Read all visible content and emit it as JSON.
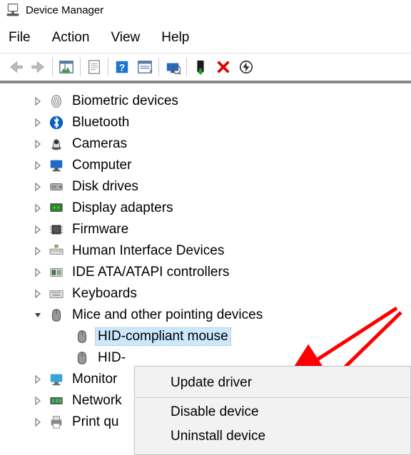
{
  "title": "Device Manager",
  "menu": [
    "File",
    "Action",
    "View",
    "Help"
  ],
  "tree": [
    {
      "name": "biometric",
      "icon": "fingerprint",
      "label": "Biometric devices",
      "level": 1,
      "expanded": false
    },
    {
      "name": "bluetooth",
      "icon": "bluetooth",
      "label": "Bluetooth",
      "level": 1,
      "expanded": false
    },
    {
      "name": "cameras",
      "icon": "camera",
      "label": "Cameras",
      "level": 1,
      "expanded": false
    },
    {
      "name": "computer",
      "icon": "computer",
      "label": "Computer",
      "level": 1,
      "expanded": false
    },
    {
      "name": "disk",
      "icon": "disk",
      "label": "Disk drives",
      "level": 1,
      "expanded": false
    },
    {
      "name": "display",
      "icon": "display",
      "label": "Display adapters",
      "level": 1,
      "expanded": false
    },
    {
      "name": "fw",
      "icon": "chip",
      "label": "Firmware",
      "level": 1,
      "expanded": false
    },
    {
      "name": "hid",
      "icon": "hid",
      "label": "Human Interface Devices",
      "level": 1,
      "expanded": false
    },
    {
      "name": "ide",
      "icon": "ide",
      "label": "IDE ATA/ATAPI controllers",
      "level": 1,
      "expanded": false
    },
    {
      "name": "kbd",
      "icon": "keyboard",
      "label": "Keyboards",
      "level": 1,
      "expanded": false
    },
    {
      "name": "mice",
      "icon": "mouse",
      "label": "Mice and other pointing devices",
      "level": 1,
      "expanded": true
    },
    {
      "name": "hid-mouse-1",
      "icon": "mouse",
      "label": "HID-compliant mouse",
      "level": 2,
      "selected": true
    },
    {
      "name": "hid-mouse-2",
      "icon": "mouse",
      "label": "HID-",
      "level": 2
    },
    {
      "name": "monitors",
      "icon": "monitor",
      "label": "Monitor",
      "level": 1,
      "expanded": false,
      "cutoff": true
    },
    {
      "name": "network",
      "icon": "network",
      "label": "Network",
      "level": 1,
      "expanded": false,
      "cutoff": true
    },
    {
      "name": "print",
      "icon": "printer",
      "label": "Print qu",
      "level": 1,
      "expanded": false,
      "cutoff": true
    }
  ],
  "context_menu": [
    {
      "label": "Update driver"
    },
    {
      "sep": true
    },
    {
      "label": "Disable device"
    },
    {
      "label": "Uninstall device"
    }
  ]
}
